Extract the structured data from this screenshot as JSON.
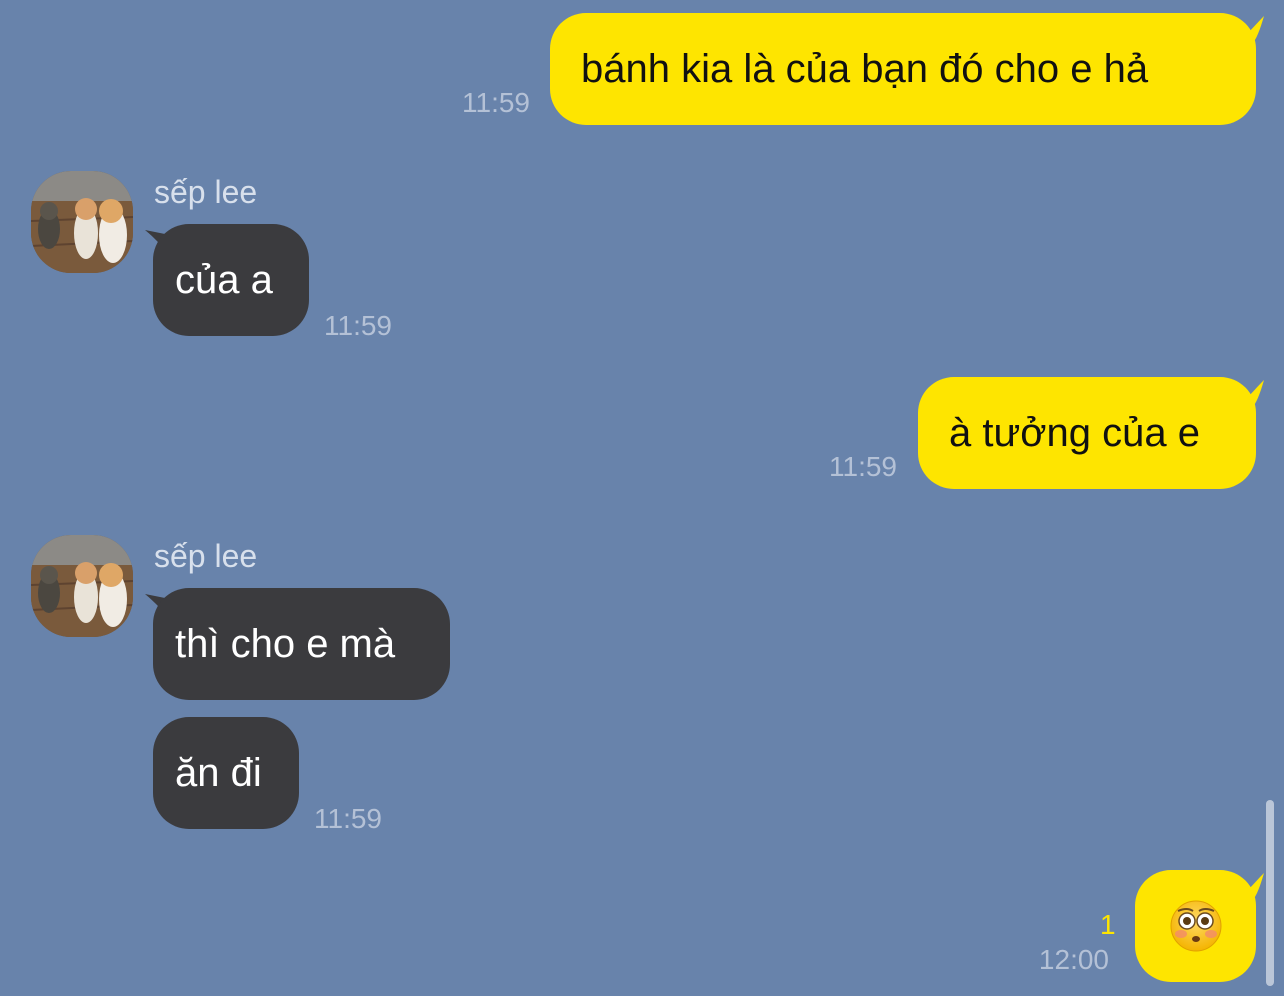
{
  "chat": {
    "messages": [
      {
        "from": "me",
        "text": "bánh kia là của bạn đó cho e hả",
        "time": "11:59"
      },
      {
        "from": "them",
        "sender": "sếp lee",
        "text": "của a",
        "time": "11:59"
      },
      {
        "from": "me",
        "text": "à tưởng của e",
        "time": "11:59"
      },
      {
        "from": "them",
        "sender": "sếp lee",
        "text": "thì cho e mà"
      },
      {
        "from": "them",
        "text": "ăn đi",
        "time": "11:59"
      },
      {
        "from": "me",
        "emoji": "flushed-face-emoji",
        "unread_count": "1",
        "time": "12:00"
      }
    ]
  },
  "colors": {
    "background": "#6883ab",
    "my_bubble": "#fee500",
    "their_bubble": "#3b3b3e",
    "timestamp": "#b4c1d6",
    "unread_indicator": "#fee500"
  }
}
